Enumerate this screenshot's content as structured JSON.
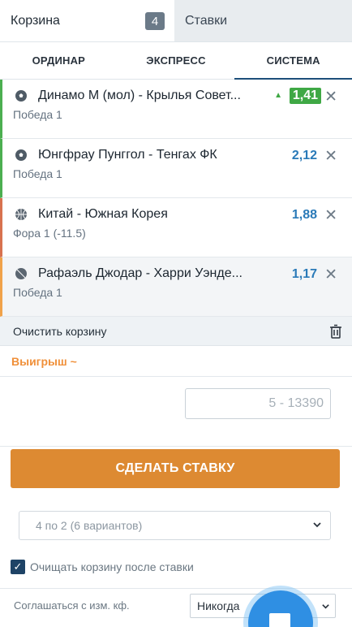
{
  "header": {
    "cart_label": "Корзина",
    "cart_count": "4",
    "bets_label": "Ставки"
  },
  "modes": [
    {
      "label": "ОРДИНАР"
    },
    {
      "label": "ЭКСПРЕСС"
    },
    {
      "label": "СИСТЕМА"
    }
  ],
  "bets": [
    {
      "event": "Динамо М (мол) - Крылья Совет...",
      "outcome": "Победа 1",
      "odd": "1,41",
      "sport_icon": "soccer-ball-icon"
    },
    {
      "event": "Юнгфрау Пунггол - Тенгах ФК",
      "outcome": "Победа 1",
      "odd": "2,12",
      "sport_icon": "soccer-ball-icon"
    },
    {
      "event": "Китай - Южная Корея",
      "outcome": "Фора 1 (-11.5)",
      "odd": "1,88",
      "sport_icon": "basketball-icon"
    },
    {
      "event": "Рафаэль Джодар - Харри Уэнде...",
      "outcome": "Победа 1",
      "odd": "1,17",
      "sport_icon": "tennis-ball-icon"
    }
  ],
  "clear_cart": {
    "label": "Очистить корзину"
  },
  "winnings": {
    "label": "Выигрыш ~"
  },
  "stake": {
    "placeholder": "5 - 13390"
  },
  "make_bet": {
    "label": "СДЕЛАТЬ СТАВКУ"
  },
  "system": {
    "selected": "4 по 2 (6 вариантов)"
  },
  "clear_after": {
    "label": "Очищать корзину после ставки",
    "checked": true
  },
  "accept_changes": {
    "label": "Соглашаться с изм. кф.",
    "selected": "Никогда"
  },
  "colors": {
    "accent": "#dd8a32",
    "odd_blue": "#2a7ab8",
    "odd_up": "#3fa845",
    "active_tab": "#1d4f7a"
  }
}
